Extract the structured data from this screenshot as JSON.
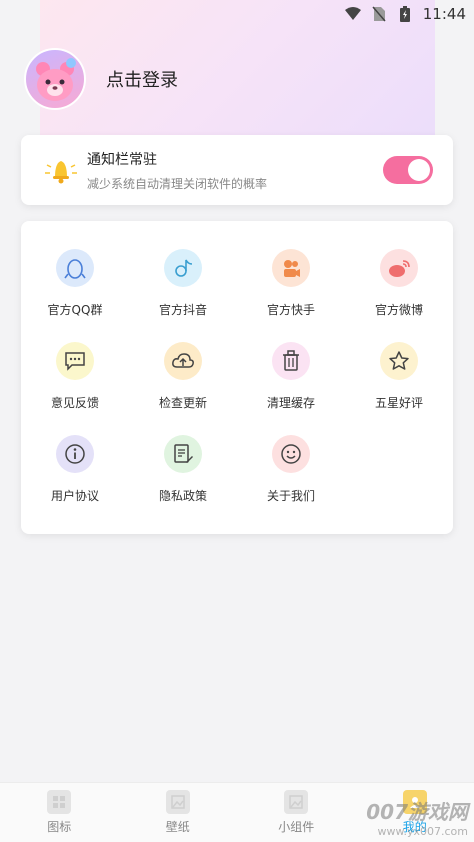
{
  "status_bar": {
    "time": "11:44",
    "icons": [
      "wifi-icon",
      "no-sim-icon",
      "battery-charging-icon"
    ]
  },
  "profile": {
    "login_label": "点击登录",
    "avatar_icon": "pink-bear-avatar"
  },
  "notice": {
    "title": "通知栏常驻",
    "subtitle": "减少系统自动清理关闭软件的概率",
    "icon": "bell-icon",
    "toggle_on": true,
    "toggle_color": "#f56e9f"
  },
  "grid": {
    "items": [
      {
        "label": "官方QQ群",
        "icon": "qq-penguin-icon",
        "bg": "#dce9fb"
      },
      {
        "label": "官方抖音",
        "icon": "douyin-icon",
        "bg": "#d9f0fb"
      },
      {
        "label": "官方快手",
        "icon": "kuaishou-icon",
        "bg": "#fde4d5"
      },
      {
        "label": "官方微博",
        "icon": "weibo-icon",
        "bg": "#fde0e0"
      },
      {
        "label": "意见反馈",
        "icon": "feedback-chat-icon",
        "bg": "#fbf7cc"
      },
      {
        "label": "检查更新",
        "icon": "cloud-upload-icon",
        "bg": "#fdebc8"
      },
      {
        "label": "清理缓存",
        "icon": "trash-icon",
        "bg": "#fbe3f3"
      },
      {
        "label": "五星好评",
        "icon": "star-icon",
        "bg": "#fdf2cf"
      },
      {
        "label": "用户协议",
        "icon": "info-icon",
        "bg": "#e4e1f8"
      },
      {
        "label": "隐私政策",
        "icon": "document-edit-icon",
        "bg": "#e0f4e0"
      },
      {
        "label": "关于我们",
        "icon": "smiley-icon",
        "bg": "#fde0e0"
      }
    ]
  },
  "bottom_nav": {
    "items": [
      {
        "label": "图标",
        "icon": "icons-tab-icon"
      },
      {
        "label": "壁纸",
        "icon": "wallpaper-tab-icon"
      },
      {
        "label": "小组件",
        "icon": "widget-tab-icon"
      },
      {
        "label": "我的",
        "icon": "profile-tab-icon"
      }
    ],
    "active_index": 3,
    "active_color": "#1aa3e8"
  },
  "watermark": {
    "main": "007游戏网",
    "sub": "www.yx007.com"
  }
}
